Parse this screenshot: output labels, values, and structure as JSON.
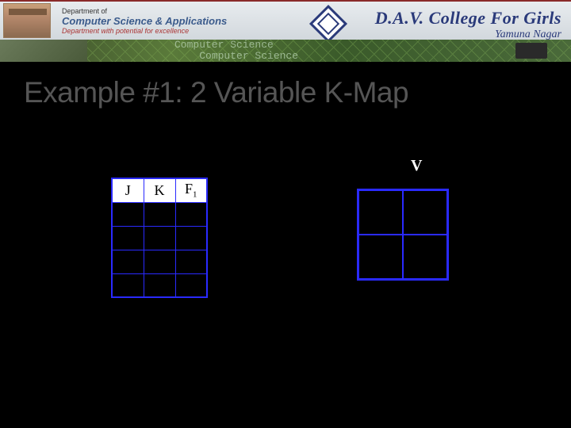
{
  "banner": {
    "dept_small": "Department of",
    "dept_main": "Computer Science & Applications",
    "dept_sub": "Department with potential for excellence",
    "college_main": "D.A.V. College For Girls",
    "college_sub": "Yamuna Nagar",
    "cs_overlay_top": "Computer Science",
    "cs_overlay_bottom": "Computer Science"
  },
  "title": "Example #1: 2 Variable K-Map",
  "truth_table": {
    "headers": [
      "J",
      "K",
      "F"
    ],
    "f_subscript": "1",
    "rows": [
      [
        "",
        "",
        ""
      ],
      [
        "",
        "",
        ""
      ],
      [
        "",
        "",
        ""
      ],
      [
        "",
        "",
        ""
      ]
    ]
  },
  "kmap": {
    "top_label": "V",
    "cells": [
      "",
      "",
      "",
      ""
    ]
  },
  "chart_data": {
    "type": "table",
    "title": "2 Variable K-Map truth table and grid",
    "truth_table_columns": [
      "J",
      "K",
      "F1"
    ],
    "truth_table_rows": 4,
    "kmap_dimensions": [
      2,
      2
    ],
    "kmap_axis_label": "V"
  }
}
